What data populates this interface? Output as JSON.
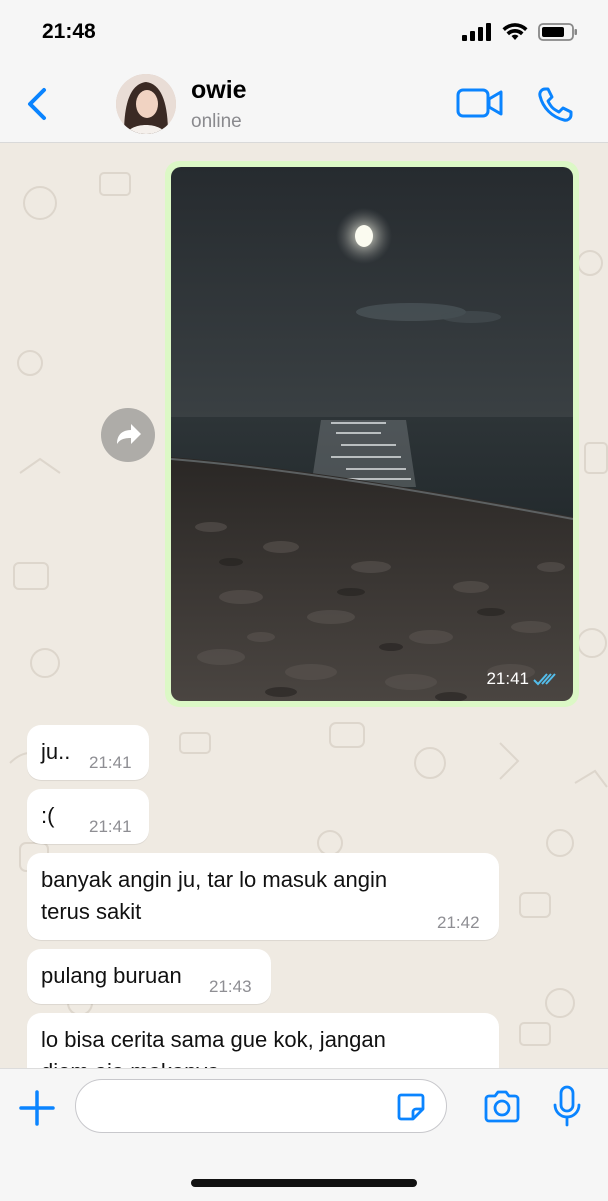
{
  "status_bar": {
    "time": "21:48"
  },
  "header": {
    "contact_name": "owie",
    "contact_status": "online"
  },
  "messages": [
    {
      "type": "image",
      "direction": "outgoing",
      "time": "21:41",
      "read": true
    },
    {
      "type": "text",
      "direction": "incoming",
      "text": "ju..",
      "time": "21:41"
    },
    {
      "type": "text",
      "direction": "incoming",
      "text": ":(",
      "time": "21:41"
    },
    {
      "type": "text",
      "direction": "incoming",
      "text_line1": "banyak angin ju, tar lo masuk angin",
      "text_line2": "terus sakit",
      "time": "21:42"
    },
    {
      "type": "text",
      "direction": "incoming",
      "text": "pulang buruan",
      "time": "21:43"
    },
    {
      "type": "text",
      "direction": "incoming",
      "text_line1": "lo bisa cerita sama gue kok, jangan",
      "text_line2": "diem aja makanya"
    }
  ],
  "composer": {
    "input_value": "",
    "placeholder": ""
  },
  "colors": {
    "accent": "#0a84ff",
    "outgoing_bubble": "#dcf8c6",
    "incoming_bubble": "#ffffff",
    "chat_background": "#efeae2",
    "read_ticks": "#53bdeb"
  },
  "icons": [
    "back-chevron-icon",
    "video-call-icon",
    "phone-icon",
    "forward-icon",
    "read-receipt-icon",
    "plus-icon",
    "sticker-icon",
    "camera-icon",
    "microphone-icon",
    "signal-icon",
    "wifi-icon",
    "battery-icon"
  ]
}
